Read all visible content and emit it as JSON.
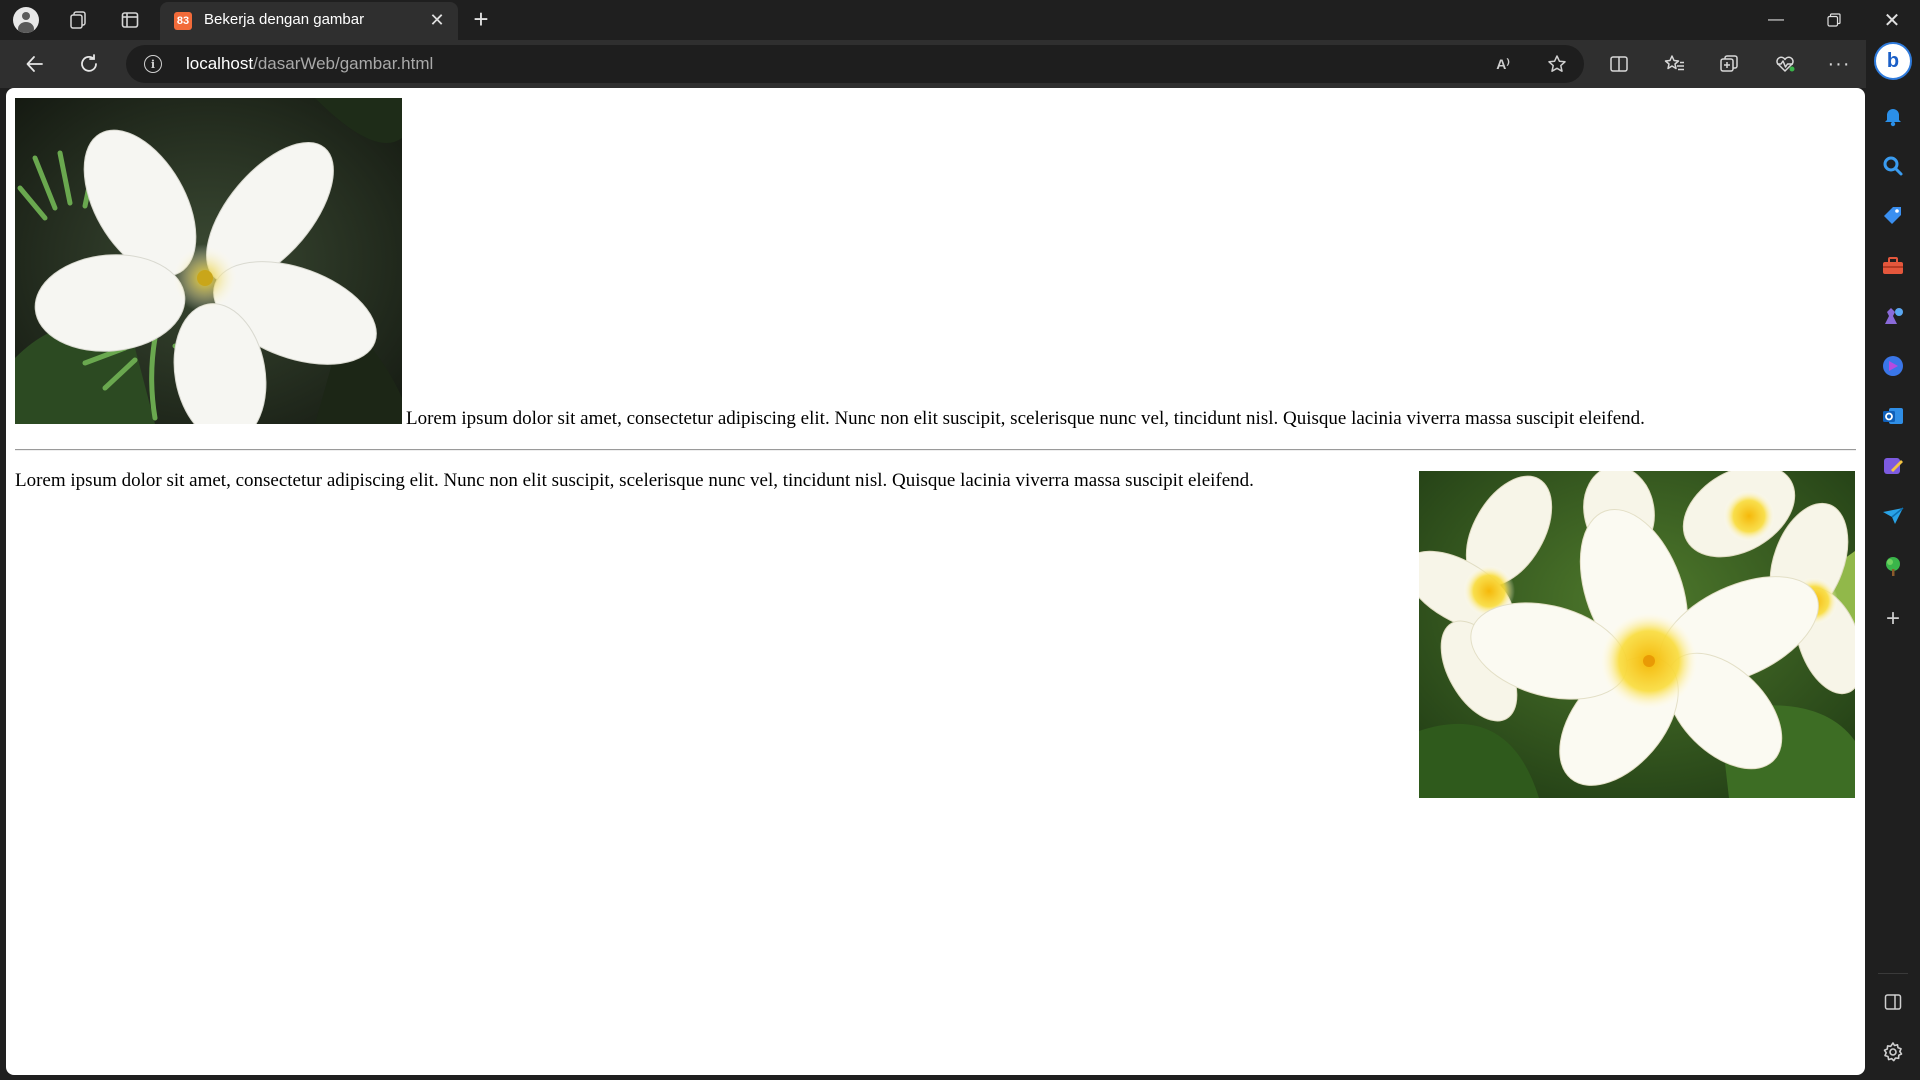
{
  "browser": {
    "tab_title": "Bekerja dengan gambar",
    "tab_favicon_text": "83",
    "address": {
      "host": "localhost",
      "path": "/dasarWeb/gambar.html"
    },
    "read_aloud_label": "A⁾",
    "more_label": "···",
    "bing_label": "b"
  },
  "page": {
    "paragraph_1": "Lorem ipsum dolor sit amet, consectetur adipiscing elit. Nunc non elit suscipit, scelerisque nunc vel, tincidunt nisl. Quisque lacinia viverra massa suscipit eleifend.",
    "paragraph_2": "Lorem ipsum dolor sit amet, consectetur adipiscing elit. Nunc non elit suscipit, scelerisque nunc vel, tincidunt nisl. Quisque lacinia viverra massa suscipit eleifend."
  },
  "colors": {
    "tab_strip": "#1f1f1f",
    "toolbar": "#2f2f2f",
    "page_background": "#ffffff",
    "accent": "#2f7bdc"
  },
  "icons": {
    "sidebar": [
      "bell-icon",
      "search-icon",
      "shopping-tag-icon",
      "tools-icon",
      "games-icon",
      "copilot-icon",
      "outlook-icon",
      "designer-icon",
      "send-icon",
      "tree-icon",
      "add-icon",
      "sidebar-panel-icon",
      "settings-icon"
    ]
  }
}
